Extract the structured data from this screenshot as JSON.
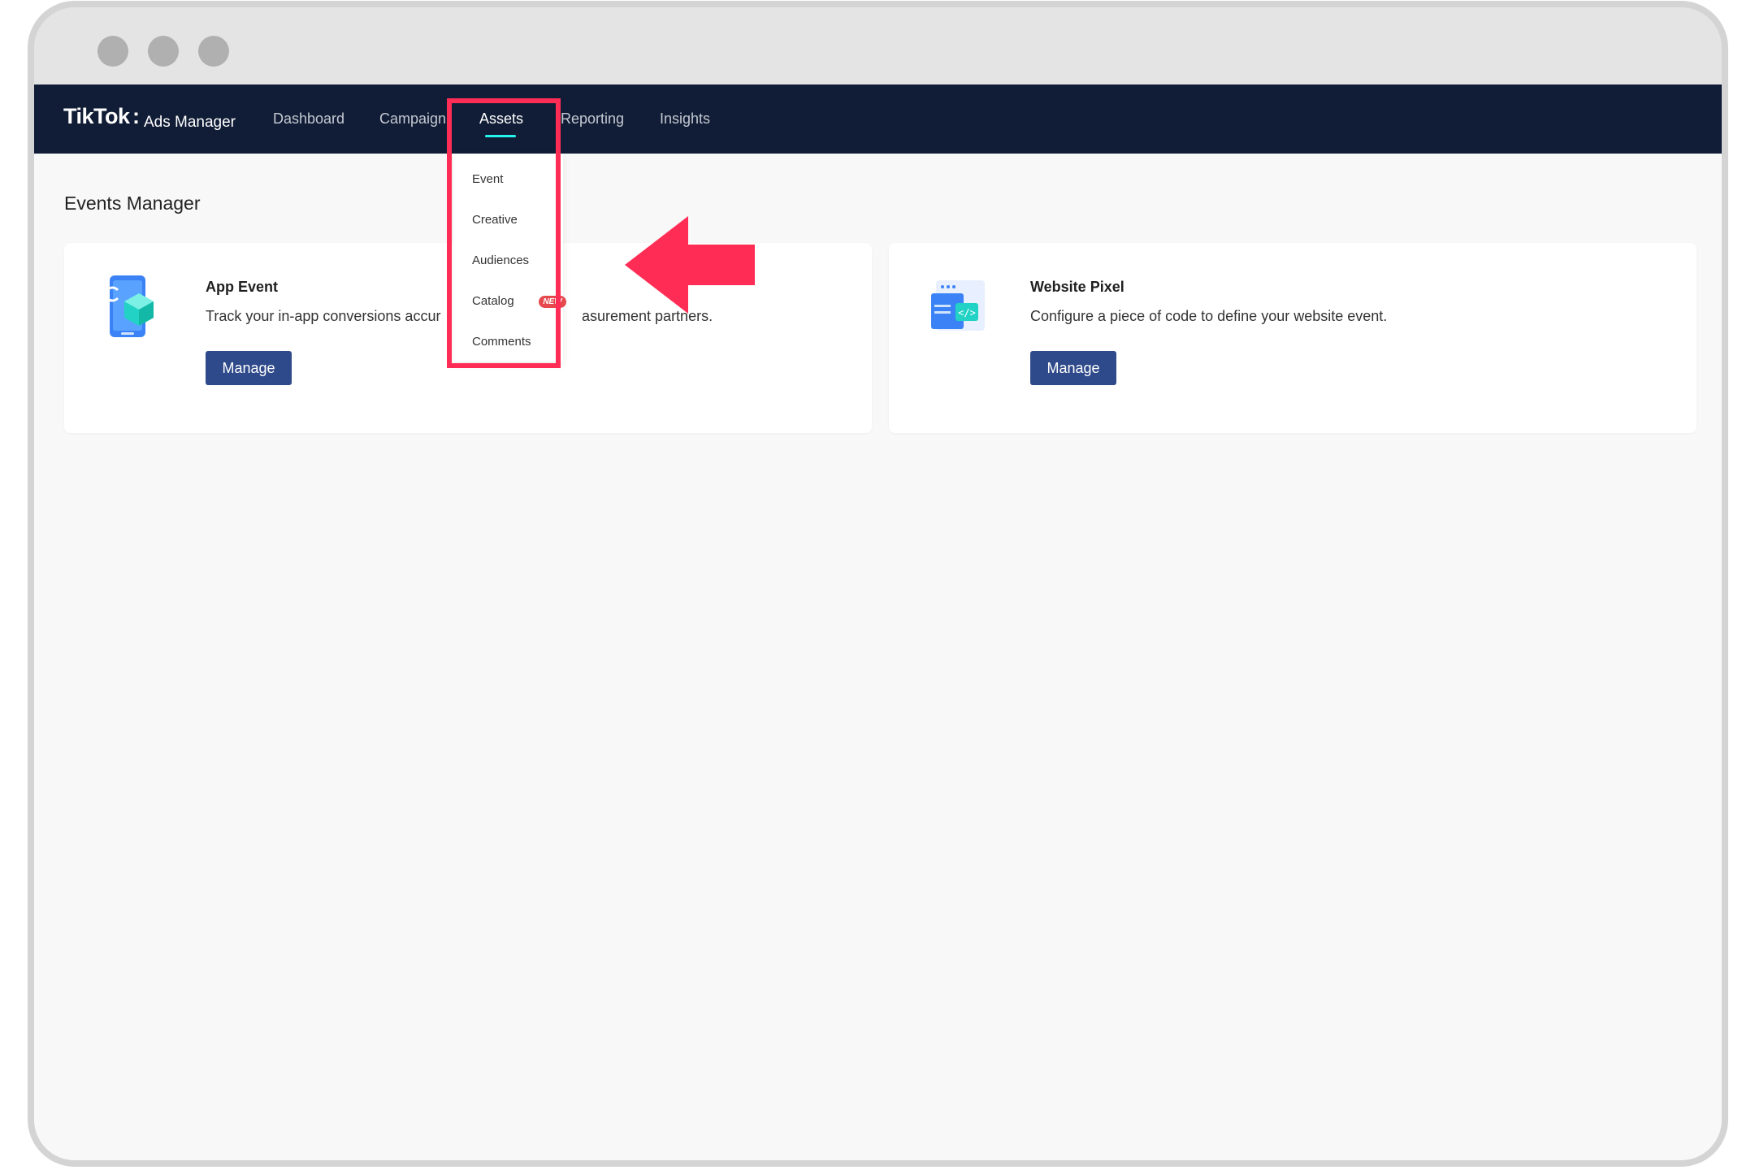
{
  "window": {
    "controls": [
      "close",
      "minimize",
      "maximize"
    ]
  },
  "header": {
    "logo": "TikTok",
    "logo_sub": "Ads Manager",
    "nav": [
      {
        "label": "Dashboard",
        "active": false
      },
      {
        "label": "Campaign",
        "active": false
      },
      {
        "label": "Assets",
        "active": true
      },
      {
        "label": "Reporting",
        "active": false
      },
      {
        "label": "Insights",
        "active": false
      }
    ]
  },
  "dropdown": {
    "items": [
      {
        "label": "Event"
      },
      {
        "label": "Creative"
      },
      {
        "label": "Audiences"
      },
      {
        "label": "Catalog",
        "badge": "NEW"
      },
      {
        "label": "Comments"
      }
    ]
  },
  "page": {
    "title": "Events Manager",
    "cards": [
      {
        "title": "App Event",
        "desc_visible_start": "Track your in-app conversions accur",
        "desc_visible_end": "asurement partners.",
        "button": "Manage",
        "icon": "app-event-icon"
      },
      {
        "title": "Website Pixel",
        "desc": "Configure a piece of code to define your website event.",
        "button": "Manage",
        "icon": "website-pixel-icon"
      }
    ]
  },
  "annotation": {
    "color": "#ff2d55"
  }
}
